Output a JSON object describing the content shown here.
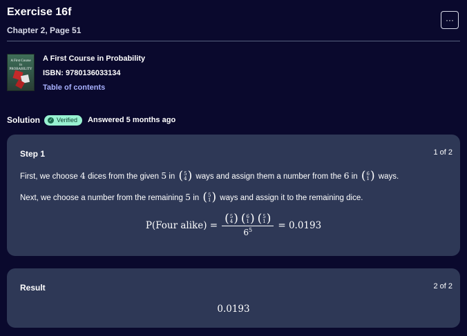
{
  "header": {
    "title": "Exercise 16f",
    "subtitle": "Chapter 2, Page 51",
    "more_label": "···"
  },
  "book": {
    "cover_title": "A First Course in PROBABILITY",
    "name": "A First Course in Probability",
    "isbn": "ISBN: 9780136033134",
    "toc_label": "Table of contents"
  },
  "solution": {
    "label": "Solution",
    "verified_label": "Verified",
    "check_glyph": "✓",
    "answered": "Answered 5 months ago"
  },
  "step1": {
    "title": "Step 1",
    "count": "1 of 2",
    "line1": {
      "a": "First, we choose ",
      "n1": "4",
      "b": " dices from the given ",
      "n2": "5",
      "c": " in ",
      "binom1_top": "5",
      "binom1_bottom": "4",
      "d": " ways and assign them a number from the ",
      "n3": "6",
      "e": " in ",
      "binom2_top": "6",
      "binom2_bottom": "1",
      "f": " ways."
    },
    "line2": {
      "a": "Next, we choose a number from the remaining ",
      "n1": "5",
      "b": " in ",
      "binom_top": "5",
      "binom_bottom": "1",
      "c": " ways and assign it to the remaining dice."
    },
    "formula": {
      "lhs": "P(Four  alike) =",
      "b1_top": "5",
      "b1_bottom": "4",
      "b2_top": "6",
      "b2_bottom": "1",
      "b3_top": "5",
      "b3_bottom": "1",
      "den_base": "6",
      "den_exp": "5",
      "rhs": "= 0.0193"
    }
  },
  "result": {
    "title": "Result",
    "count": "2 of 2",
    "value": "0.0193"
  },
  "colors": {
    "background": "#0a092d",
    "card": "#2e3856",
    "verified_badge": "#98f1d1",
    "link": "#a8b1ff"
  }
}
